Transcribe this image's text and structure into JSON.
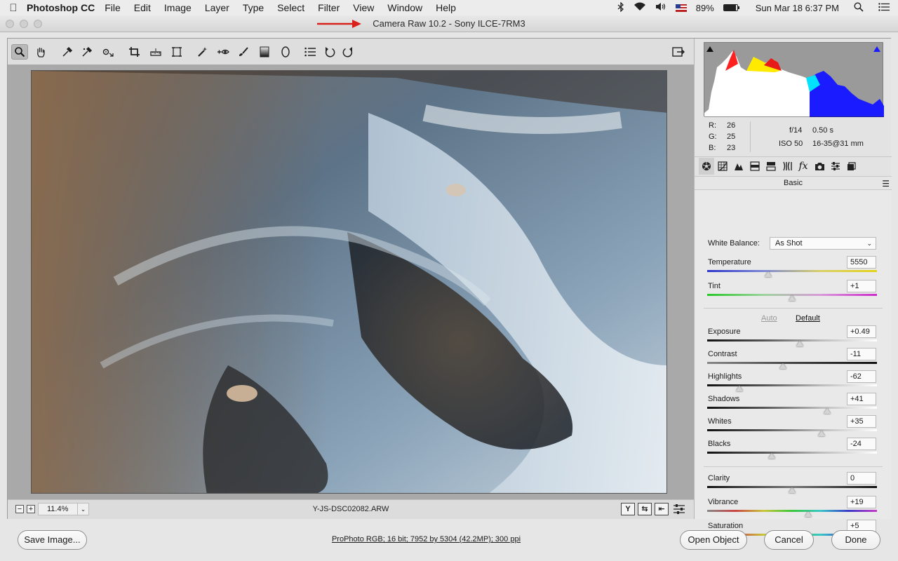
{
  "menubar": {
    "app_name": "Photoshop CC",
    "menus": [
      "File",
      "Edit",
      "Image",
      "Layer",
      "Type",
      "Select",
      "Filter",
      "View",
      "Window",
      "Help"
    ],
    "battery": "89%",
    "clock": "Sun Mar 18  6:37 PM"
  },
  "window": {
    "title": "Camera Raw 10.2  -  Sony ILCE-7RM3"
  },
  "toolbar": {
    "tools": [
      "zoom-tool",
      "hand-tool",
      "white-balance-tool",
      "color-sampler-tool",
      "targeted-adjustment-tool",
      "crop-tool",
      "straighten-tool",
      "transform-tool",
      "spot-removal-tool",
      "red-eye-tool",
      "adjustment-brush",
      "graduated-filter",
      "radial-filter",
      "preferences",
      "rotate-left",
      "rotate-right"
    ],
    "active_tool": "zoom-tool"
  },
  "preview": {
    "zoom": "11.4%",
    "filename": "Y-JS-DSC02082.ARW"
  },
  "info": {
    "r_label": "R:",
    "r": "26",
    "g_label": "G:",
    "g": "25",
    "b_label": "B:",
    "b": "23",
    "aperture": "f/14",
    "shutter": "0.50 s",
    "iso": "ISO 50",
    "lens": "16-35@31 mm"
  },
  "panel": {
    "section_title": "Basic",
    "white_balance_label": "White Balance:",
    "white_balance_value": "As Shot",
    "auto_label": "Auto",
    "default_label": "Default",
    "sliders": [
      {
        "label": "Temperature",
        "value": "5550",
        "position": 0.36
      },
      {
        "label": "Tint",
        "value": "+1",
        "position": 0.5
      },
      {
        "label": "Exposure",
        "value": "+0.49",
        "position": 0.545
      },
      {
        "label": "Contrast",
        "value": "-11",
        "position": 0.445
      },
      {
        "label": "Highlights",
        "value": "-62",
        "position": 0.19
      },
      {
        "label": "Shadows",
        "value": "+41",
        "position": 0.705
      },
      {
        "label": "Whites",
        "value": "+35",
        "position": 0.675
      },
      {
        "label": "Blacks",
        "value": "-24",
        "position": 0.38
      },
      {
        "label": "Clarity",
        "value": "0",
        "position": 0.5
      },
      {
        "label": "Vibrance",
        "value": "+19",
        "position": 0.595
      },
      {
        "label": "Saturation",
        "value": "+5",
        "position": 0.525
      }
    ]
  },
  "footer": {
    "save_label": "Save Image...",
    "workflow_text": "ProPhoto RGB; 16 bit; 7952 by 5304 (42.2MP); 300 ppi",
    "open_label": "Open Object",
    "cancel_label": "Cancel",
    "done_label": "Done"
  }
}
